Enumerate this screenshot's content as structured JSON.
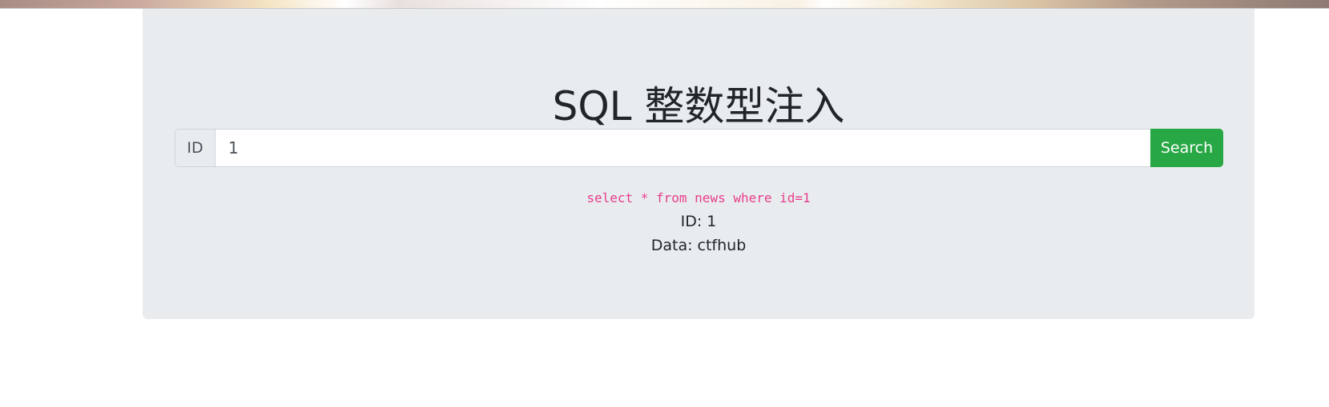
{
  "page": {
    "title": "SQL 整数型注入"
  },
  "search": {
    "prepend_label": "ID",
    "value": "1",
    "button_label": "Search"
  },
  "result": {
    "query": "select * from news where id=1",
    "id_line": "ID: 1",
    "data_line": "Data: ctfhub"
  },
  "colors": {
    "background": "#e9ecef",
    "button": "#28a745",
    "code": "#e83e8c"
  }
}
